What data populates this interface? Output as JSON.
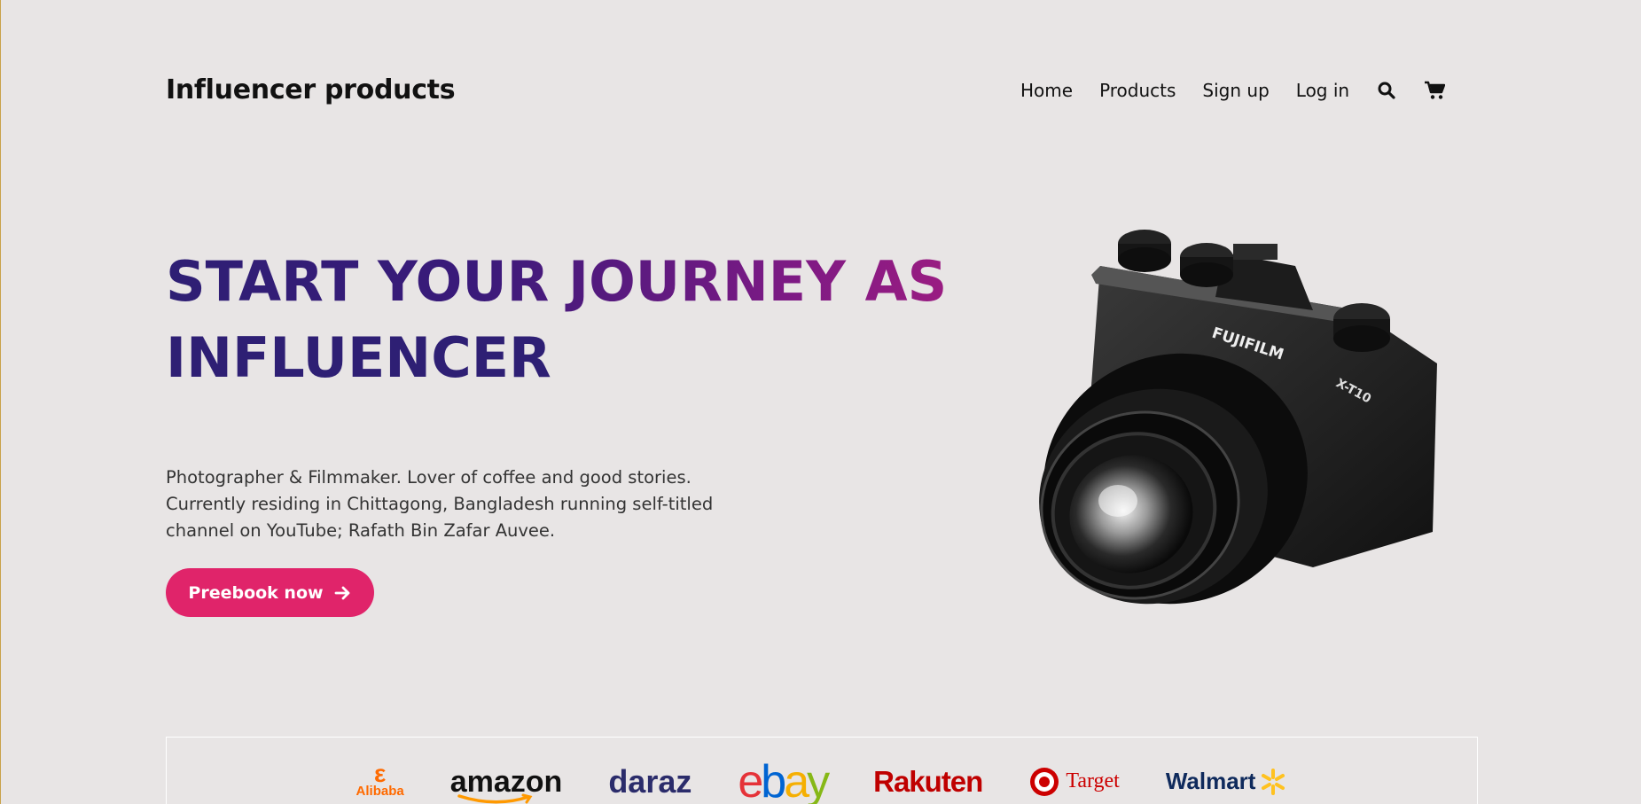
{
  "header": {
    "brand": "Influencer products",
    "nav": [
      {
        "label": "Home"
      },
      {
        "label": "Products"
      },
      {
        "label": "Sign up"
      },
      {
        "label": "Log in"
      }
    ],
    "icons": [
      "search-icon",
      "cart-icon"
    ]
  },
  "hero": {
    "title_line1": "START YOUR JOURNEY AS",
    "title_line2": "INFLUENCER",
    "description": "Photographer & Filmmaker. Lover of coffee and good stories. Currently residing in Chittagong, Bangladesh running self-titled channel on YouTube; Rafath Bin Zafar Auvee.",
    "cta_label": "Preebook now",
    "image_text": {
      "brand": "FUJIFILM",
      "model": "X-T10"
    }
  },
  "brands": [
    {
      "name": "Alibaba",
      "color": "#ff6a00"
    },
    {
      "name": "amazon",
      "color": "#111111"
    },
    {
      "name": "daraz",
      "color": "#2b2c6b"
    },
    {
      "name": "ebay",
      "colors": [
        "#e53238",
        "#0064d2",
        "#f5af02",
        "#86b817"
      ]
    },
    {
      "name": "Rakuten",
      "color": "#bf0000"
    },
    {
      "name": "Target",
      "color": "#cc0000"
    },
    {
      "name": "Walmart",
      "color": "#0f2a5c",
      "accent": "#ffc220"
    }
  ],
  "colors": {
    "background": "#e8e5e5",
    "title_primary": "#2e1f74",
    "title_accent": "#9a1c82",
    "cta": "#e0246a"
  }
}
